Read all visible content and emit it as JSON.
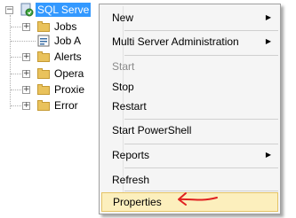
{
  "tree": {
    "root_label": "SQL Serve",
    "items": [
      {
        "label": "Jobs",
        "icon": "folder-icon"
      },
      {
        "label": "Job A",
        "icon": "job-activity-icon"
      },
      {
        "label": "Alerts",
        "icon": "folder-icon"
      },
      {
        "label": "Opera",
        "icon": "folder-icon"
      },
      {
        "label": "Proxie",
        "icon": "folder-icon"
      },
      {
        "label": "Error",
        "icon": "folder-icon"
      }
    ],
    "expander_symbol": "+",
    "collapse_symbol": "−"
  },
  "menu": {
    "items": [
      {
        "label": "New",
        "submenu": true,
        "enabled": true
      },
      {
        "label": "Multi Server Administration",
        "submenu": true,
        "enabled": true
      },
      {
        "label": "Start",
        "submenu": false,
        "enabled": false
      },
      {
        "label": "Stop",
        "submenu": false,
        "enabled": true
      },
      {
        "label": "Restart",
        "submenu": false,
        "enabled": true
      },
      {
        "label": "Start PowerShell",
        "submenu": false,
        "enabled": true
      },
      {
        "label": "Reports",
        "submenu": true,
        "enabled": true
      },
      {
        "label": "Refresh",
        "submenu": false,
        "enabled": true
      },
      {
        "label": "Properties",
        "submenu": false,
        "enabled": true,
        "highlighted": true
      }
    ],
    "submenu_arrow": "▶"
  },
  "colors": {
    "selection": "#3399ff",
    "highlight": "#fcefbd",
    "annotation_arrow": "#e02020"
  }
}
